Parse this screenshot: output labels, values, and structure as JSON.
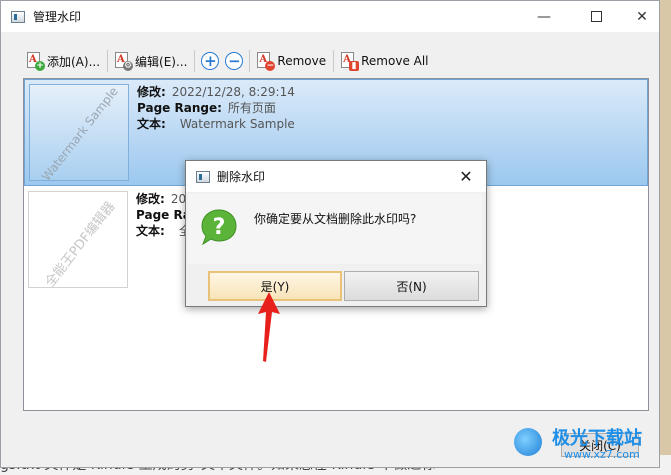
{
  "window": {
    "title": "管理水印",
    "controls": {
      "minimize": "—",
      "maximize": "",
      "close": "✕"
    }
  },
  "toolbar": {
    "add_label": "添加(A)...",
    "edit_label": "编辑(E)...",
    "zoom_in": "+",
    "zoom_out": "−",
    "remove_label": "Remove",
    "remove_all_label": "Remove All"
  },
  "watermarks": [
    {
      "thumb_text": "Watermark Sample",
      "modified_label": "修改:",
      "modified_value": "2022/12/28, 8:29:14",
      "range_label": "Page Range:",
      "range_value": "所有页面",
      "text_label": "文本:",
      "text_value": "Watermark Sample",
      "selected": true
    },
    {
      "thumb_text": "全能王PDF编辑器",
      "modified_label": "修改:",
      "modified_value": "20",
      "range_label": "Page Ra",
      "range_value": "",
      "text_label": "文本:",
      "text_value": "全",
      "selected": false
    }
  ],
  "footer": {
    "close_label": "关闭(C)"
  },
  "dialog": {
    "title": "删除水印",
    "close": "✕",
    "message": "你确定要从文档删除此水印吗?",
    "yes_label": "是(Y)",
    "no_label": "否(N)"
  },
  "background": {
    "bottom_text": "gs.txt 文件是 Kindle 生成的剪\"文本文件。如果您在 Kindle 中做过标"
  },
  "logo": {
    "name": "极光下载站",
    "url": "www.xz7.com"
  },
  "colors": {
    "selection": "#9cc8ef",
    "accent": "#2b7bd3",
    "arrow": "#e8201c"
  }
}
